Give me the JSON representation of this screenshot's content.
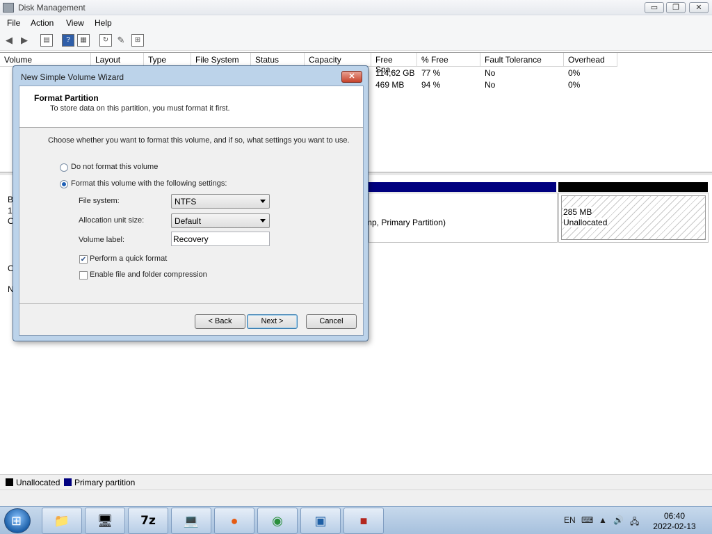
{
  "window": {
    "title": "Disk Management",
    "buttons": {
      "minimize": "▭",
      "restore": "❐",
      "close": "✕"
    }
  },
  "menu": [
    "File",
    "Action",
    "View",
    "Help"
  ],
  "toolbar_icons": [
    "back-arrow-icon",
    "forward-arrow-icon",
    "properties-icon",
    "help-icon",
    "list-view-icon",
    "refresh-icon",
    "settings-icon",
    "disk-icon"
  ],
  "volume_table": {
    "columns": [
      "Volume",
      "Layout",
      "Type",
      "File System",
      "Status",
      "Capacity",
      "Free Spa...",
      "% Free",
      "Fault Tolerance",
      "Overhead"
    ],
    "rows": [
      {
        "free_space": "114,62 GB",
        "percent_free": "77 %",
        "fault_tolerance": "No",
        "overhead": "0%"
      },
      {
        "free_space": "469 MB",
        "percent_free": "94 %",
        "fault_tolerance": "No",
        "overhead": "0%"
      }
    ]
  },
  "graphical": {
    "left_stubs": [
      "B",
      "1",
      "O",
      "C",
      "N"
    ],
    "partition_text": "mp, Primary Partition)",
    "unallocated": {
      "size": "285 MB",
      "label": "Unallocated"
    }
  },
  "legend": [
    {
      "label": "Unallocated",
      "color": "#000000"
    },
    {
      "label": "Primary partition",
      "color": "#00007f"
    }
  ],
  "wizard": {
    "title": "New Simple Volume Wizard",
    "close": "✕",
    "heading": "Format Partition",
    "subheading": "To store data on this partition, you must format it first.",
    "instruction": "Choose whether you want to format this volume, and if so, what settings you want to use.",
    "radio_no_format": "Do not format this volume",
    "radio_format": "Format this volume with the following settings:",
    "file_system_label": "File system:",
    "file_system_value": "NTFS",
    "alloc_label": "Allocation unit size:",
    "alloc_value": "Default",
    "volume_label_label": "Volume label:",
    "volume_label_value": "Recovery",
    "quick_format": "Perform a quick format",
    "quick_format_checked": true,
    "compression": "Enable file and folder compression",
    "compression_checked": false,
    "back": "< Back",
    "next": "Next >",
    "cancel": "Cancel"
  },
  "taskbar": {
    "apps": [
      "explorer-icon",
      "control-panel-icon",
      "7zip-icon",
      "remote-desktop-icon",
      "firefox-icon",
      "chrome-icon",
      "network-icon",
      "toolbox-icon"
    ],
    "app_7z": "7z",
    "lang": "EN",
    "time": "06:40",
    "date": "2022-02-13"
  }
}
